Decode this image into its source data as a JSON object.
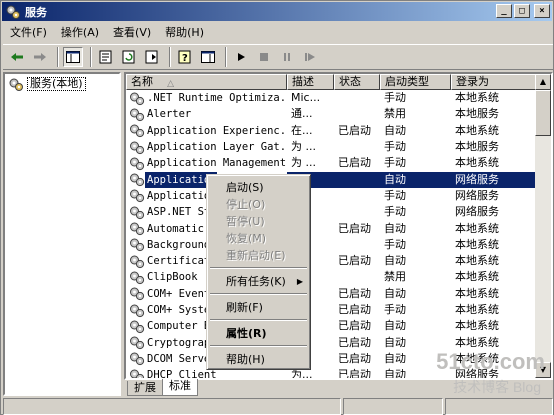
{
  "window": {
    "title": "服务"
  },
  "title_buttons": [
    "_",
    "□",
    "×"
  ],
  "menu": [
    {
      "label": "文件(F)"
    },
    {
      "label": "操作(A)"
    },
    {
      "label": "查看(V)"
    },
    {
      "label": "帮助(H)"
    }
  ],
  "tree": {
    "root_label": "服务(本地)"
  },
  "columns": [
    "名称",
    "描述",
    "状态",
    "启动类型",
    "登录为"
  ],
  "services": [
    {
      "name": ".NET Runtime Optimiza...",
      "desc": "Mic...",
      "status": "",
      "startup": "手动",
      "logon": "本地系统"
    },
    {
      "name": "Alerter",
      "desc": "通...",
      "status": "",
      "startup": "禁用",
      "logon": "本地服务"
    },
    {
      "name": "Application Experienc...",
      "desc": "在...",
      "status": "已启动",
      "startup": "自动",
      "logon": "本地系统"
    },
    {
      "name": "Application Layer Gat...",
      "desc": "为 ...",
      "status": "",
      "startup": "手动",
      "logon": "本地服务"
    },
    {
      "name": "Application Management",
      "desc": "为 ...",
      "status": "已启动",
      "startup": "手动",
      "logon": "本地系统"
    },
    {
      "name": "Application",
      "desc": "...",
      "status": "",
      "startup": "自动",
      "logon": "网络服务",
      "selected": true
    },
    {
      "name": "Application",
      "desc": "...",
      "status": "",
      "startup": "手动",
      "logon": "网络服务"
    },
    {
      "name": "ASP.NET Sta",
      "desc": "...",
      "status": "",
      "startup": "手动",
      "logon": "网络服务"
    },
    {
      "name": "Automatic U",
      "desc": "...",
      "status": "已启动",
      "startup": "自动",
      "logon": "本地系统"
    },
    {
      "name": "Background",
      "desc": "...",
      "status": "",
      "startup": "手动",
      "logon": "本地系统"
    },
    {
      "name": "Certificate",
      "desc": "...",
      "status": "已启动",
      "startup": "自动",
      "logon": "本地系统"
    },
    {
      "name": "ClipBook",
      "desc": "...",
      "status": "",
      "startup": "禁用",
      "logon": "本地系统"
    },
    {
      "name": "COM+ Event",
      "desc": "...",
      "status": "已启动",
      "startup": "自动",
      "logon": "本地系统"
    },
    {
      "name": "COM+ System",
      "desc": "...",
      "status": "已启动",
      "startup": "手动",
      "logon": "本地系统"
    },
    {
      "name": "Computer Br",
      "desc": "...",
      "status": "已启动",
      "startup": "自动",
      "logon": "本地系统"
    },
    {
      "name": "Cryptograph",
      "desc": "...",
      "status": "已启动",
      "startup": "自动",
      "logon": "本地系统"
    },
    {
      "name": "DCOM Server",
      "desc": "...",
      "status": "已启动",
      "startup": "自动",
      "logon": "本地系统"
    },
    {
      "name": "DHCP Client",
      "desc": "为...",
      "status": "已启动",
      "startup": "自动",
      "logon": "网络服务"
    }
  ],
  "context_menu": {
    "start": "启动(S)",
    "stop": "停止(O)",
    "pause": "暂停(U)",
    "resume": "恢复(M)",
    "restart": "重新启动(E)",
    "all_tasks": "所有任务(K)",
    "refresh": "刷新(F)",
    "properties": "属性(R)",
    "help": "帮助(H)"
  },
  "tabs": [
    {
      "label": "扩展"
    },
    {
      "label": "标准",
      "active": true
    }
  ],
  "watermark": {
    "site": "51cto.com",
    "sub": "技术博客  Blog"
  },
  "colors": {
    "title_start": "#0a246a",
    "title_end": "#a6caf0",
    "selection": "#0a246a",
    "face": "#d4d0c8"
  }
}
